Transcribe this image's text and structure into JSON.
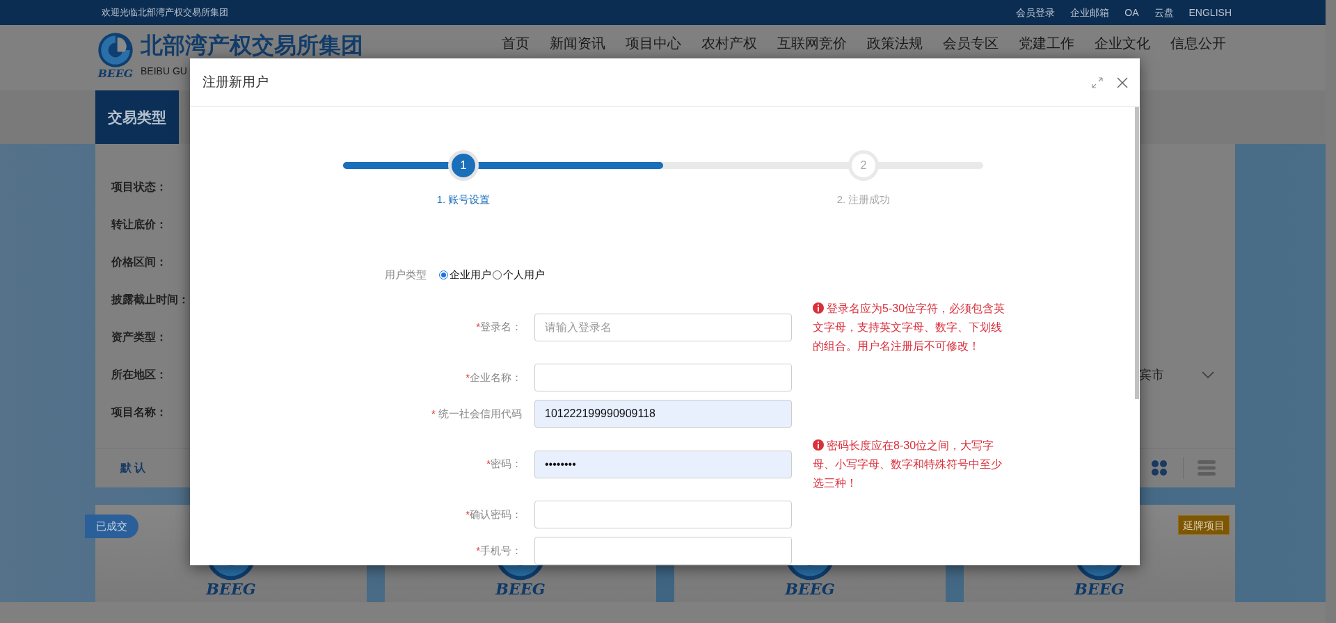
{
  "top_bar": {
    "welcome": "欢迎光临北部湾产权交易所集团",
    "links": [
      "会员登录",
      "企业邮箱",
      "OA",
      "云盘",
      "ENGLISH"
    ]
  },
  "header": {
    "logo_mark": "BEEG",
    "title": "北部湾产权交易所集团",
    "subtitle": "BEIBU GU",
    "nav": [
      "首页",
      "新闻资讯",
      "项目中心",
      "农村产权",
      "互联网竞价",
      "政策法规",
      "会员专区",
      "党建工作",
      "企业文化",
      "信息公开"
    ]
  },
  "section_tab": "交易类型",
  "filters": [
    {
      "label": "项目状态："
    },
    {
      "label": "转让底价："
    },
    {
      "label": "价格区间："
    },
    {
      "label": "披露截止时间："
    },
    {
      "label": "资产类型："
    },
    {
      "label": "所在地区：",
      "value": "宾市"
    },
    {
      "label": "项目名称："
    }
  ],
  "sort": {
    "label": "默 认"
  },
  "views": [
    {
      "kind": "grid",
      "selected": true
    },
    {
      "kind": "list",
      "selected": false
    }
  ],
  "cards": [
    {
      "badge": "已成交",
      "kind": "deal",
      "logo": "BEEG"
    },
    {
      "logo": "BEEG"
    },
    {
      "logo": "BEEG"
    },
    {
      "badge": "延牌项目",
      "kind": "extended",
      "logo": "BEEG"
    }
  ],
  "dialog": {
    "title": "注册新用户",
    "steps": [
      {
        "number": "1",
        "label": "1. 账号设置",
        "selected": true
      },
      {
        "number": "2",
        "label": "2. 注册成功",
        "selected": false
      }
    ],
    "progress": {
      "level": 0.5
    },
    "user_type": {
      "label": "用户类型",
      "options": [
        {
          "label": "企业用户",
          "selected": true
        },
        {
          "label": "个人用户",
          "selected": false
        }
      ]
    },
    "fields": [
      {
        "required_mark": "*",
        "label": "登录名：",
        "placeholder": "请输入登录名",
        "autofilled": false,
        "hint": "登录名应为5-30位字符，必须包含英文字母，支持英文字母、数字、下划线的组合。用户名注册后不可修改！"
      },
      {
        "required_mark": "*",
        "label": "企业名称：",
        "autofilled": false
      },
      {
        "required_mark": "*",
        "label": " 统一社会信用代码",
        "value": "101222199990909118",
        "autofilled": true
      },
      {
        "required_mark": "*",
        "label": "密码：",
        "value": "••••••••",
        "autofilled": true,
        "hint": "密码长度应在8-30位之间，大写字母、小写字母、数字和特殊符号中至少选三种！"
      },
      {
        "required_mark": "*",
        "label": "确认密码：",
        "autofilled": false
      },
      {
        "required_mark": "*",
        "label": "手机号：",
        "autofilled": false
      }
    ]
  }
}
